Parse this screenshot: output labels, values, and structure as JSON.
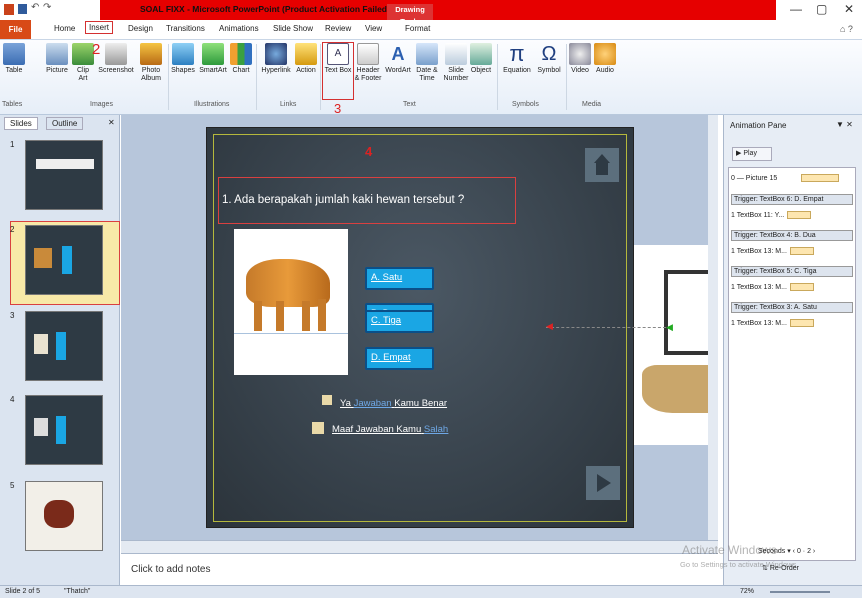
{
  "titlebar": {
    "title": "SOAL FIXX - Microsoft PowerPoint (Product Activation Failed)",
    "context_tab": "Drawing Tools",
    "minimize": "—",
    "restore": "▢",
    "close": "✕"
  },
  "tabs": {
    "file": "File",
    "home": "Home",
    "insert": "Insert",
    "design": "Design",
    "transitions": "Transitions",
    "animations": "Animations",
    "slideshow": "Slide Show",
    "review": "Review",
    "view": "View",
    "format": "Format"
  },
  "ribbon": {
    "table": "Table",
    "picture": "Picture",
    "clipart": "Clip Art",
    "screenshot": "Screenshot",
    "photoalbum": "Photo Album",
    "shapes": "Shapes",
    "smartart": "SmartArt",
    "chart": "Chart",
    "hyperlink": "Hyperlink",
    "action": "Action",
    "textbox": "Text Box",
    "header": "Header & Footer",
    "wordart": "WordArt",
    "datetime": "Date & Time",
    "slidenum": "Slide Number",
    "object": "Object",
    "equation": "Equation",
    "symbol": "Symbol",
    "video": "Video",
    "audio": "Audio",
    "groups": {
      "tables": "Tables",
      "images": "Images",
      "illustrations": "Illustrations",
      "links": "Links",
      "text": "Text",
      "symbols": "Symbols",
      "media": "Media"
    },
    "annot2": "2",
    "annot3": "3"
  },
  "slidepanel": {
    "slides_tab": "Slides",
    "outline_tab": "Outline",
    "close": "✕",
    "nums": [
      "1",
      "2",
      "3",
      "4",
      "5"
    ]
  },
  "slide": {
    "annot4": "4",
    "question": "1. Ada berapakah jumlah kaki hewan tersebut ?",
    "answers": [
      "A. Satu",
      "B. Dua",
      "C. Tiga",
      "D. Empat"
    ],
    "fb1_a": "Ya",
    "fb1_b": "Jawaban",
    "fb1_c": "Kamu Benar",
    "fb2_a": "Maaf Jawaban Kamu",
    "fb2_b": "Salah"
  },
  "anim": {
    "title": "Animation Pane",
    "play": "Play",
    "picture": "0 — Picture 15",
    "triggers": [
      {
        "label": "Trigger: TextBox 6: D. Empat",
        "item": "1 TextBox 11: Y..."
      },
      {
        "label": "Trigger: TextBox 4: B. Dua",
        "item": "1 TextBox 13: M..."
      },
      {
        "label": "Trigger: TextBox 5: C. Tiga",
        "item": "1 TextBox 13: M..."
      },
      {
        "label": "Trigger: TextBox 3: A. Satu",
        "item": "1 TextBox 13: M..."
      }
    ],
    "seconds": "Seconds",
    "sec0": "0",
    "sec2": "2",
    "reorder": "Re-Order",
    "watermark": "Activate Windows",
    "watermark2": "Go to Settings to activate Windows."
  },
  "notes": {
    "placeholder": "Click to add notes"
  },
  "status": {
    "slide": "Slide 2 of 5",
    "theme": "\"Thatch\"",
    "zoom": "72%"
  }
}
